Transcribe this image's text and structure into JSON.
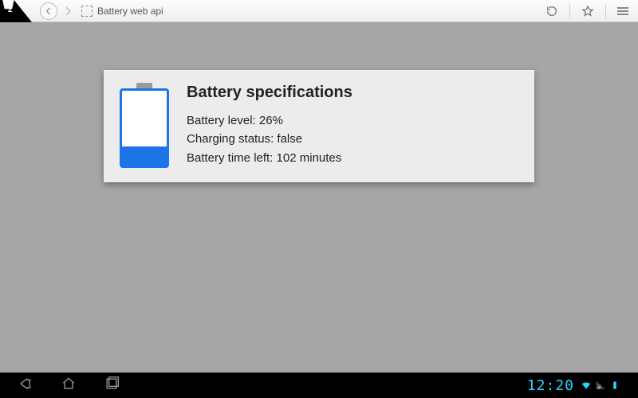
{
  "browser": {
    "tab_count": "2",
    "page_title": "Battery web api"
  },
  "card": {
    "heading": "Battery specifications",
    "level_label": "Battery level",
    "level_value": "26%",
    "level_percent": 26,
    "charging_label": "Charging status",
    "charging_value": "false",
    "time_label": "Battery time left",
    "time_value": "102 minutes"
  },
  "system": {
    "clock": "12:20"
  }
}
